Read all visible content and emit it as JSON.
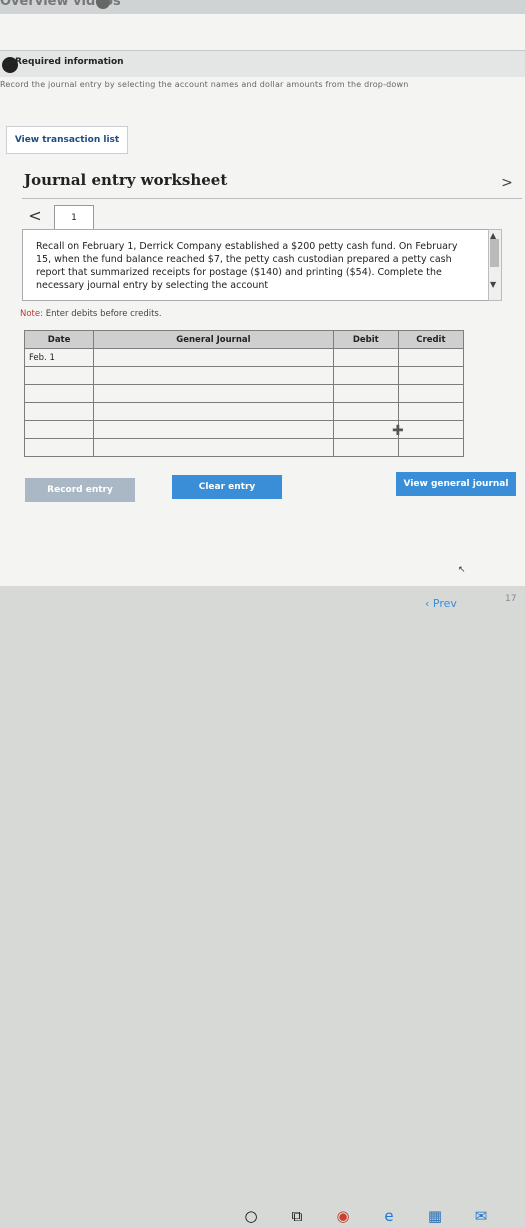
{
  "top": {
    "title_fragment": "Overview videos"
  },
  "required": {
    "label": "Required information"
  },
  "instruction_scribble": "Record the journal entry by selecting the account names and dollar amounts from the drop-down",
  "view_transaction_list": "View transaction list",
  "worksheet_title": "Journal entry worksheet",
  "tab": {
    "label": "1"
  },
  "nav": {
    "prev": "<",
    "next": ">"
  },
  "panel": {
    "text": "Recall on February 1, Derrick Company established a $200 petty cash fund. On February 15, when the fund balance reached $7, the petty cash custodian prepared a petty cash report that summarized receipts for postage ($140) and printing ($54). Complete the necessary journal entry by selecting the account"
  },
  "note": {
    "prefix": "Note:",
    "text": " Enter debits before credits."
  },
  "table": {
    "headers": [
      "Date",
      "General Journal",
      "Debit",
      "Credit"
    ],
    "rows": [
      [
        "Feb. 1",
        "",
        "",
        ""
      ],
      [
        "",
        "",
        "",
        ""
      ],
      [
        "",
        "",
        "",
        ""
      ],
      [
        "",
        "",
        "",
        ""
      ],
      [
        "",
        "",
        "",
        ""
      ],
      [
        "",
        "",
        "",
        ""
      ]
    ]
  },
  "buttons": {
    "record": "Record entry",
    "clear": "Clear entry",
    "view_general_journal": "View general journal"
  },
  "footer": {
    "prev": "Prev",
    "page": "17"
  },
  "taskbar_icons": [
    "circle-icon",
    "task-view-icon",
    "chrome-icon",
    "edge-icon",
    "store-icon",
    "mail-icon"
  ]
}
